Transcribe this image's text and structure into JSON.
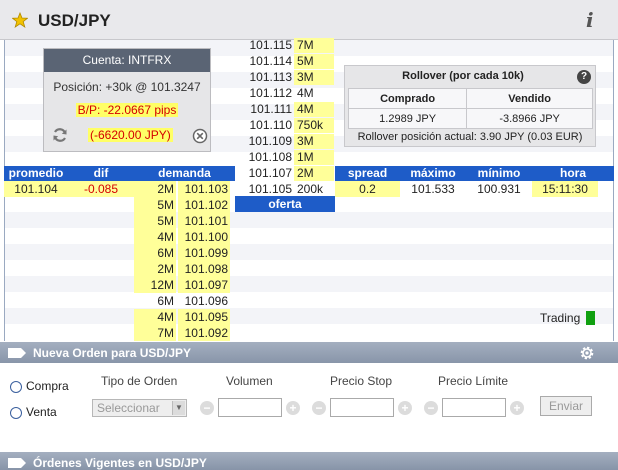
{
  "header": {
    "title": "USD/JPY",
    "info_symbol": "i"
  },
  "offer_ladder": [
    {
      "price": "101.115",
      "size": "7M",
      "highlight": true
    },
    {
      "price": "101.114",
      "size": "5M",
      "highlight": true
    },
    {
      "price": "101.113",
      "size": "3M",
      "highlight": true
    },
    {
      "price": "101.112",
      "size": "4M",
      "highlight": false
    },
    {
      "price": "101.111",
      "size": "4M",
      "highlight": true
    },
    {
      "price": "101.110",
      "size": "750k",
      "highlight": true
    },
    {
      "price": "101.109",
      "size": "3M",
      "highlight": true
    },
    {
      "price": "101.108",
      "size": "1M",
      "highlight": true
    },
    {
      "price": "101.107",
      "size": "2M",
      "highlight": true
    },
    {
      "price": "101.105",
      "size": "200k",
      "highlight": false
    }
  ],
  "account": {
    "title": "Cuenta: INTFRX",
    "position": "Posición: +30k @ 101.3247",
    "bp": "B/P: -22.0667 pips",
    "pnl": "(-6620.00 JPY)"
  },
  "rollover": {
    "title": "Rollover (por cada 10k)",
    "help": "?",
    "col_bought": "Comprado",
    "col_sold": "Vendido",
    "bought": "1.2989 JPY",
    "sold": "-3.8966 JPY",
    "footer": "Rollover posición actual: 3.90 JPY (0.03 EUR)"
  },
  "quote_headers": {
    "promedio": "promedio",
    "dif": "dif",
    "demanda": "demanda",
    "spread": "spread",
    "maximo": "máximo",
    "minimo": "mínimo",
    "hora": "hora",
    "oferta": "oferta"
  },
  "quote": {
    "promedio": "101.104",
    "dif": "-0.085",
    "spread": "0.2",
    "maximo": "101.533",
    "minimo": "100.931",
    "hora": "15:11:30"
  },
  "demand_ladder": [
    {
      "size": "2M",
      "price": "101.103",
      "highlight": true
    },
    {
      "size": "5M",
      "price": "101.102",
      "highlight": true
    },
    {
      "size": "5M",
      "price": "101.101",
      "highlight": true
    },
    {
      "size": "4M",
      "price": "101.100",
      "highlight": true
    },
    {
      "size": "6M",
      "price": "101.099",
      "highlight": true
    },
    {
      "size": "2M",
      "price": "101.098",
      "highlight": true
    },
    {
      "size": "12M",
      "price": "101.097",
      "highlight": true
    },
    {
      "size": "6M",
      "price": "101.096",
      "highlight": false
    },
    {
      "size": "4M",
      "price": "101.095",
      "highlight": true
    },
    {
      "size": "7M",
      "price": "101.092",
      "highlight": true
    }
  ],
  "status": {
    "trading": "Trading",
    "color": "#10a010"
  },
  "new_order": {
    "bar_label": "Nueva Orden para USD/JPY",
    "buy": "Compra",
    "sell": "Venta",
    "order_type_label": "Tipo de Orden",
    "order_type_placeholder": "Seleccionar",
    "volume_label": "Volumen",
    "stop_label": "Precio Stop",
    "limit_label": "Precio Límite",
    "send": "Enviar"
  },
  "pending_orders": {
    "bar_label": "Órdenes Vigentes en USD/JPY"
  }
}
